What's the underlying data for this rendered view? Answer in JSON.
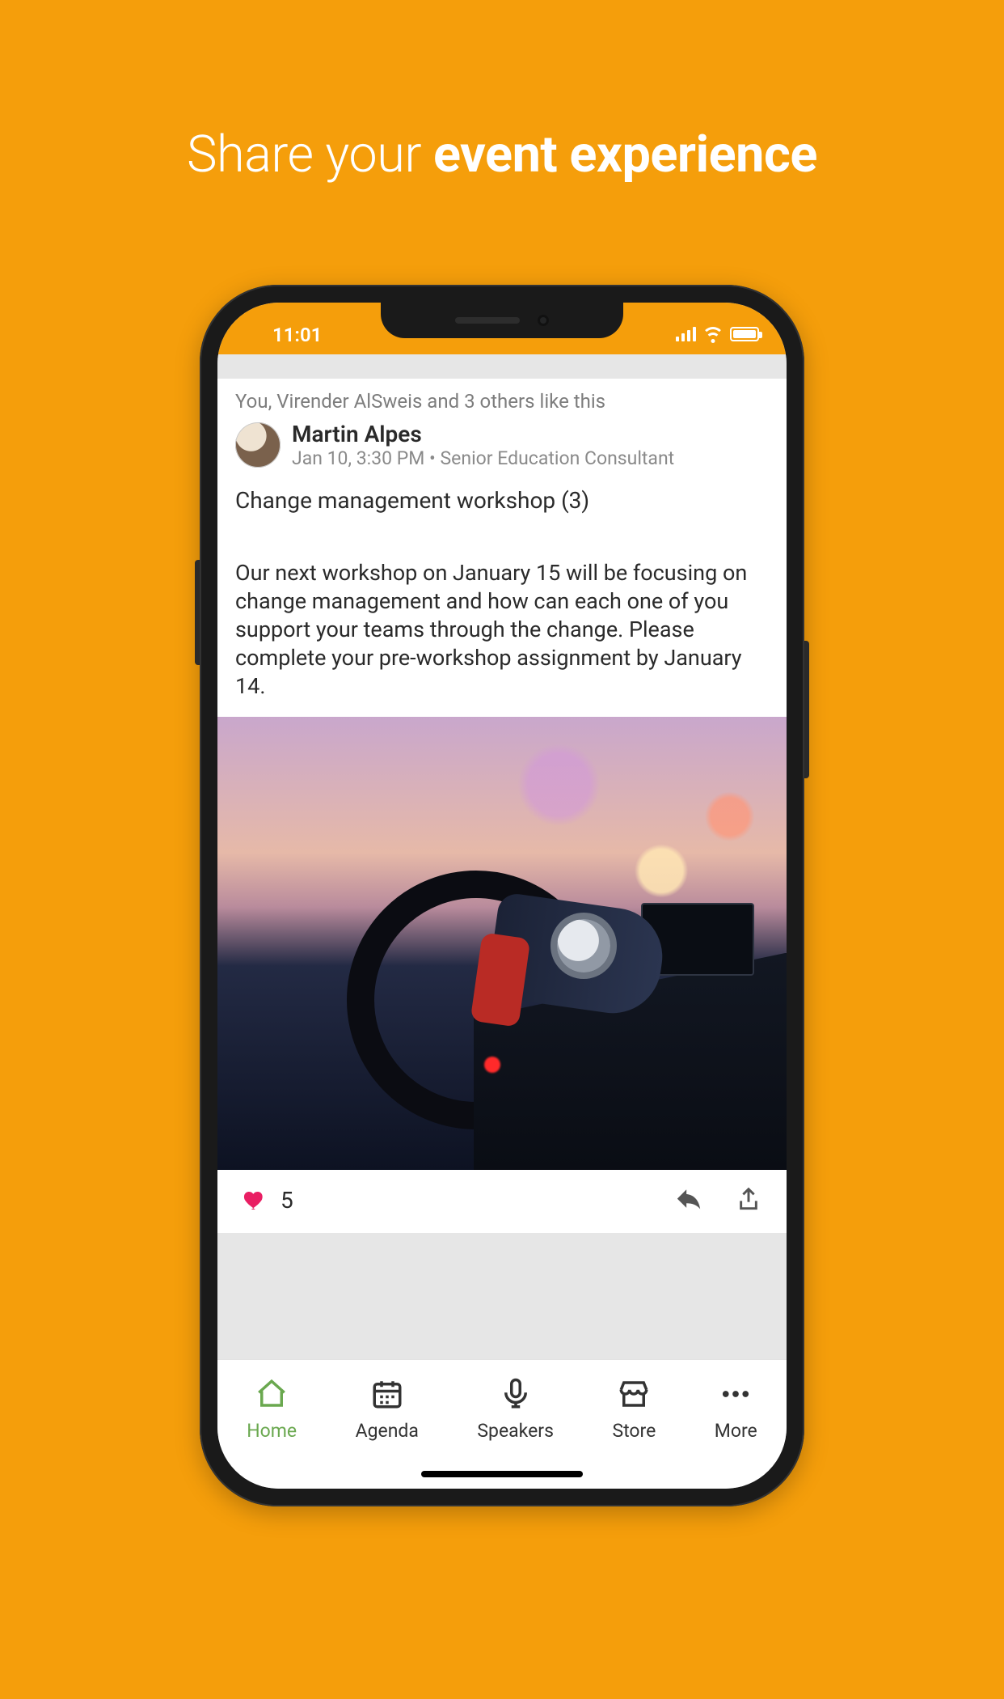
{
  "headline": {
    "prefix": "Share your ",
    "bold": "event experience"
  },
  "status": {
    "time": "11:01"
  },
  "post": {
    "likes_line": "You, Virender AlSweis and 3 others like this",
    "author": {
      "name": "Martin Alpes",
      "timestamp": "Jan 10, 3:30 PM",
      "separator": " • ",
      "role": "Senior Education Consultant"
    },
    "title": "Change management workshop (3)",
    "body": "Our next workshop on January 15 will be focusing on change management and how can each one of you support your teams through the change. Please complete your pre-workshop assignment by January 14.",
    "like_count": "5"
  },
  "tabs": [
    {
      "label": "Home"
    },
    {
      "label": "Agenda"
    },
    {
      "label": "Speakers"
    },
    {
      "label": "Store"
    },
    {
      "label": "More"
    }
  ],
  "colors": {
    "brand": "#f59e0b",
    "heart": "#e91e63",
    "tab_active": "#6aa84f"
  }
}
